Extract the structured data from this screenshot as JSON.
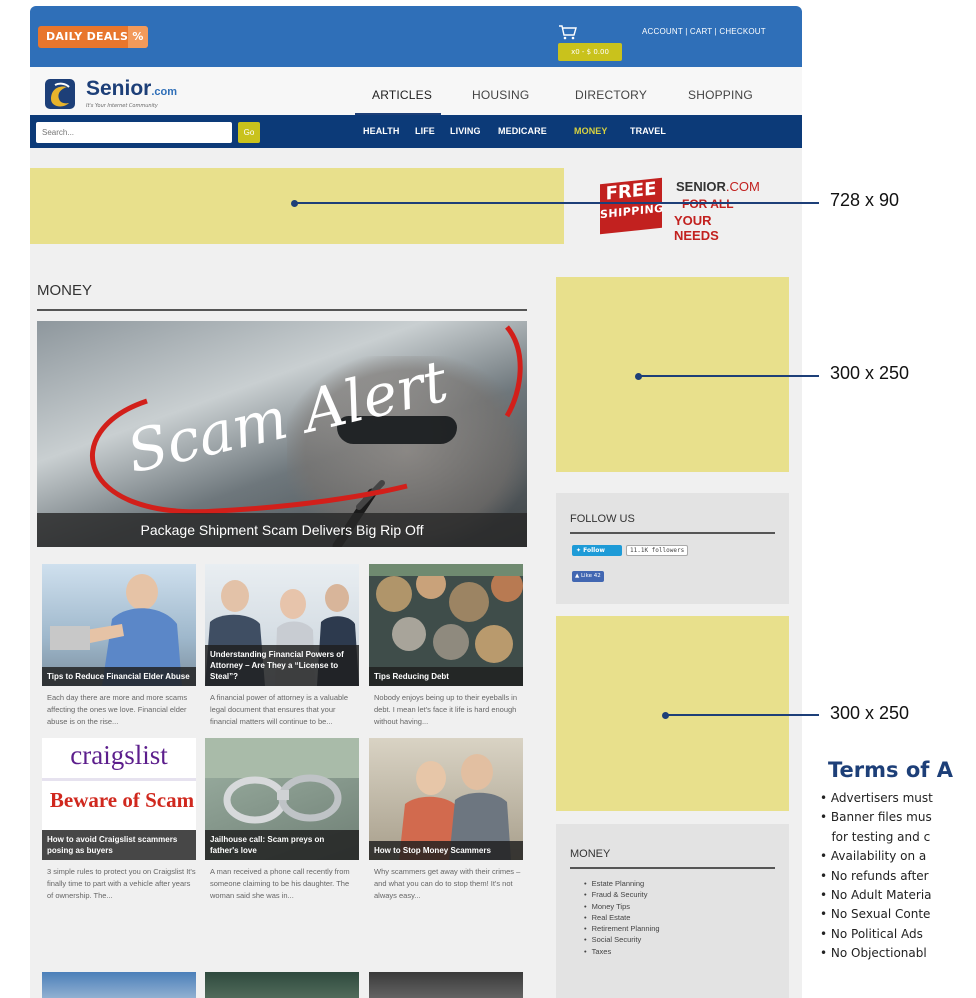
{
  "topbar": {
    "daily_deals": "DAILY DEALS",
    "daily_deals_pct": "%",
    "cart_total": "x0 - $ 0.00",
    "account_links": "ACCOUNT | CART | CHECKOUT"
  },
  "logo": {
    "name": "Senior",
    "suffix": ".com",
    "tagline": "It's Your Internet Community"
  },
  "main_nav": [
    "ARTICLES",
    "HOUSING",
    "DIRECTORY",
    "SHOPPING"
  ],
  "sub_nav": {
    "search_placeholder": "Search...",
    "go": "Go",
    "items": [
      "HEALTH",
      "LIFE",
      "LIVING",
      "MEDICARE",
      "MONEY",
      "TRAVEL"
    ],
    "active": "MONEY"
  },
  "free_ship": {
    "free": "FREE",
    "shipping": "SHIPPING",
    "senior": "SENIOR",
    "com": ".COM",
    "for_all": "FOR ALL",
    "your_needs": "YOUR NEEDS"
  },
  "section": {
    "title": "MONEY",
    "hero_text": "Scam Alert",
    "hero_caption": "Package Shipment Scam Delivers Big Rip Off"
  },
  "articles": [
    {
      "title": "Tips to Reduce Financial Elder Abuse",
      "desc": "Each day there are more and more scams affecting the ones we love. Financial elder abuse is on the rise..."
    },
    {
      "title": "Understanding Financial Powers of Attorney – Are They a “License to Steal”?",
      "desc": "A financial power of attorney is a valuable legal document that ensures that your financial matters will continue to be..."
    },
    {
      "title": "Tips Reducing Debt",
      "desc": "Nobody enjoys being up to their eyeballs in debt. I mean let's face it life is hard enough without having..."
    },
    {
      "title": "How to avoid Craigslist scammers posing as buyers",
      "desc": "3 simple rules to protect you on Craigslist It's finally time to part with a vehicle after years of ownership. The...",
      "thumb_word": "craigslist",
      "thumb_word2": "Beware of Scam"
    },
    {
      "title": "Jailhouse call: Scam preys on father's love",
      "desc": "A man received a phone call recently from someone claiming to be his daughter. The woman said she was in..."
    },
    {
      "title": "How to Stop Money Scammers",
      "desc": "Why scammers get away with their crimes – and what you can do to stop them! It's not always easy..."
    }
  ],
  "follow": {
    "title": "FOLLOW US",
    "twitter_label": "Follow",
    "twitter_count": "11.1K followers",
    "facebook_label": "Like 42"
  },
  "money_box": {
    "title": "MONEY",
    "items": [
      "Estate Planning",
      "Fraud & Security",
      "Money Tips",
      "Real Estate",
      "Retirement Planning",
      "Social Security",
      "Taxes"
    ]
  },
  "callouts": [
    "728 x 90",
    "300 x 250",
    "300 x 250"
  ],
  "terms": {
    "title": "Terms of A",
    "items": [
      "• Advertisers must",
      "• Banner files mus",
      "   for testing and c",
      "• Availability on a",
      "• No refunds after",
      "• No Adult Materia",
      "• No Sexual Conte",
      "• No Political Ads",
      "• No Objectionabl"
    ]
  },
  "colors": {
    "brand_blue": "#2f6fb8",
    "navy": "#0c3a78",
    "accent_yellow": "#c9c21c",
    "ad_placeholder": "#e8e08c",
    "terms_heading": "#1d3f78"
  }
}
